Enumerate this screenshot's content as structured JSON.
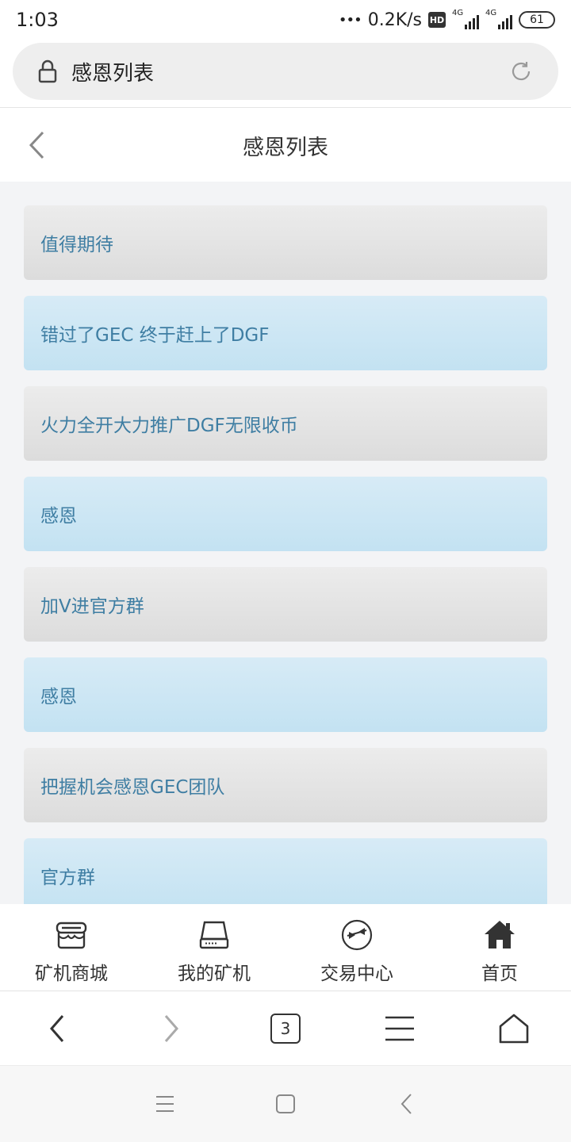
{
  "status_bar": {
    "time": "1:03",
    "dots": "•••",
    "speed": "0.2K/s",
    "hd": "HD",
    "network1": "4G",
    "network2": "4G",
    "battery": "61"
  },
  "url_bar": {
    "title": "感恩列表"
  },
  "header": {
    "title": "感恩列表"
  },
  "list": {
    "items": [
      {
        "label": "值得期待",
        "style": "gray"
      },
      {
        "label": "错过了GEC 终于赶上了DGF",
        "style": "blue"
      },
      {
        "label": "火力全开大力推广DGF无限收币",
        "style": "gray"
      },
      {
        "label": "感恩",
        "style": "blue"
      },
      {
        "label": "加V进官方群",
        "style": "gray"
      },
      {
        "label": "感恩",
        "style": "blue"
      },
      {
        "label": "把握机会感恩GEC团队",
        "style": "gray"
      },
      {
        "label": "官方群",
        "style": "blue"
      }
    ]
  },
  "tab_nav": {
    "items": [
      {
        "label": "矿机商城",
        "icon": "store-icon"
      },
      {
        "label": "我的矿机",
        "icon": "drive-icon"
      },
      {
        "label": "交易中心",
        "icon": "exchange-icon"
      },
      {
        "label": "首页",
        "icon": "home-icon"
      }
    ]
  },
  "browser_bar": {
    "tab_count": "3"
  },
  "colors": {
    "list_text": "#3f7ea3",
    "gray_item": "#e3e3e3",
    "blue_item": "#cce6f4",
    "content_bg": "#f3f4f6"
  }
}
